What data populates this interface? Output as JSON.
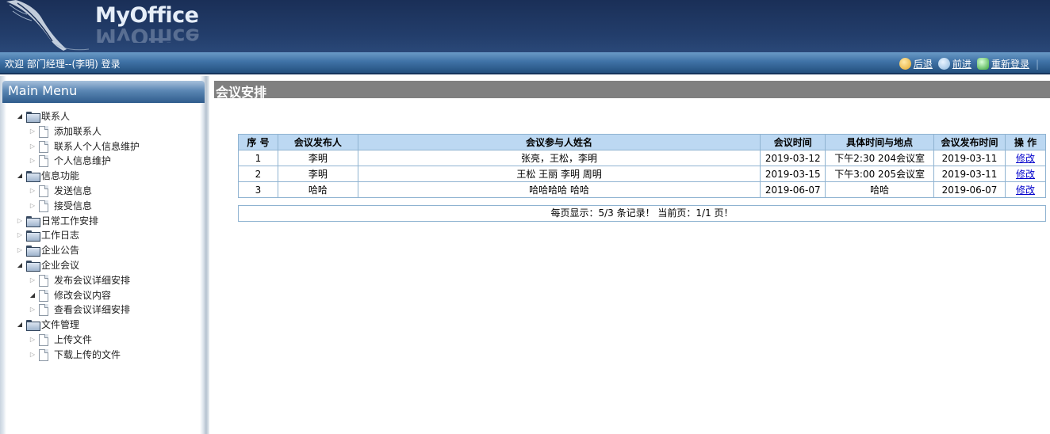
{
  "header": {
    "logo": "MyOffice",
    "logo_reflection": "MyOffice",
    "welcome": "欢迎 部门经理--(李明) 登录",
    "back": "后退",
    "forward": "前进",
    "relogin": "重新登录",
    "separator": "|"
  },
  "sidebar": {
    "title": "Main Menu",
    "tree": [
      {
        "label": "联系人",
        "level": 0,
        "type": "folder",
        "expanded": true
      },
      {
        "label": "添加联系人",
        "level": 1,
        "type": "doc",
        "expanded": false
      },
      {
        "label": "联系人个人信息维护",
        "level": 1,
        "type": "doc",
        "expanded": false
      },
      {
        "label": "个人信息维护",
        "level": 1,
        "type": "doc",
        "expanded": false
      },
      {
        "label": "信息功能",
        "level": 0,
        "type": "folder",
        "expanded": true
      },
      {
        "label": "发送信息",
        "level": 1,
        "type": "doc",
        "expanded": false
      },
      {
        "label": "接受信息",
        "level": 1,
        "type": "doc",
        "expanded": false
      },
      {
        "label": "日常工作安排",
        "level": 0,
        "type": "folder",
        "expanded": false
      },
      {
        "label": "工作日志",
        "level": 0,
        "type": "folder",
        "expanded": false
      },
      {
        "label": "企业公告",
        "level": 0,
        "type": "folder",
        "expanded": false
      },
      {
        "label": "企业会议",
        "level": 0,
        "type": "folder",
        "expanded": true
      },
      {
        "label": "发布会议详细安排",
        "level": 1,
        "type": "doc",
        "expanded": false
      },
      {
        "label": "修改会议内容",
        "level": 1,
        "type": "doc",
        "expanded": true
      },
      {
        "label": "查看会议详细安排",
        "level": 1,
        "type": "doc",
        "expanded": false
      },
      {
        "label": "文件管理",
        "level": 0,
        "type": "folder",
        "expanded": true
      },
      {
        "label": "上传文件",
        "level": 1,
        "type": "doc",
        "expanded": false
      },
      {
        "label": "下载上传的文件",
        "level": 1,
        "type": "doc",
        "expanded": false
      }
    ]
  },
  "main": {
    "title": "会议安排",
    "table": {
      "columns": [
        "序 号",
        "会议发布人",
        "会议参与人姓名",
        "会议时间",
        "具体时间与地点",
        "会议发布时间",
        "操 作"
      ],
      "rows": [
        [
          "1",
          "李明",
          "张亮，王松，李明",
          "2019-03-12",
          "下午2:30 204会议室",
          "2019-03-11",
          "修改"
        ],
        [
          "2",
          "李明",
          "王松 王丽 李明 周明",
          "2019-03-15",
          "下午3:00 205会议室",
          "2019-03-11",
          "修改"
        ],
        [
          "3",
          "哈哈",
          "哈哈哈哈 哈哈",
          "2019-06-07",
          "哈哈",
          "2019-06-07",
          "修改"
        ]
      ]
    },
    "pager": "每页显示：5/3 条记录！ 当前页：1/1 页！"
  }
}
